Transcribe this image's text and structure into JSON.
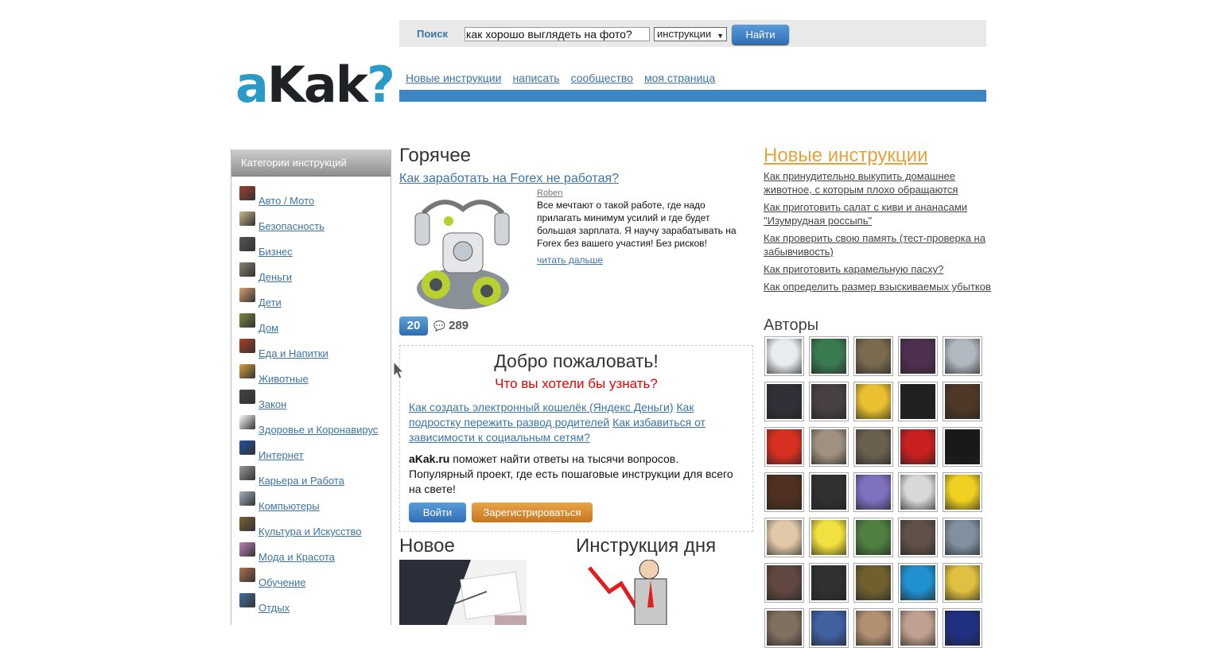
{
  "search": {
    "label": "Поиск",
    "value": "как хорошо выглядеть на фото?",
    "select_value": "инструкции",
    "button": "Найти"
  },
  "logo": {
    "part1": "a",
    "part2": "Kak",
    "part3": "?"
  },
  "nav": [
    "Новые инструкции",
    "написать",
    "сообщество",
    "моя страница"
  ],
  "sidebar": {
    "title": "Категории инструкций",
    "items": [
      {
        "label": "Авто / Мото",
        "color": "#a04030"
      },
      {
        "label": "Безопасность",
        "color": "#c9b58a"
      },
      {
        "label": "Бизнес",
        "color": "#555555"
      },
      {
        "label": "Деньги",
        "color": "#8a8070"
      },
      {
        "label": "Дети",
        "color": "#d9a070"
      },
      {
        "label": "Дом",
        "color": "#7a8a40"
      },
      {
        "label": "Еда и Напитки",
        "color": "#b04020"
      },
      {
        "label": "Животные",
        "color": "#d9a040"
      },
      {
        "label": "Закон",
        "color": "#444444"
      },
      {
        "label": "Здоровье и Коронавирус",
        "color": "#ffffff"
      },
      {
        "label": "Интернет",
        "color": "#2050a0"
      },
      {
        "label": "Карьера и Работа",
        "color": "#999999"
      },
      {
        "label": "Компьютеры",
        "color": "#a0b0c0"
      },
      {
        "label": "Культура и Искусство",
        "color": "#806030"
      },
      {
        "label": "Мода и Красота",
        "color": "#c080c0"
      },
      {
        "label": "Обучение",
        "color": "#b07050"
      },
      {
        "label": "Отдых",
        "color": "#4070a0"
      }
    ]
  },
  "hot": {
    "title": "Горячее",
    "link": "Как заработать на Forex не работая?",
    "author": "Roben",
    "text": "Все мечтают о такой работе, где надо прилагать минимум усилий и где будет большая зарплата. Я научу зарабатывать на Forex без вашего участия! Без рисков!",
    "read_more": "читать дальше",
    "rating": "20",
    "comments": "289"
  },
  "welcome": {
    "title": "Добро пожаловать!",
    "subtitle": "Что вы хотели бы узнать?",
    "links": [
      "Как создать электронный кошелёк (Яндекс Деньги)",
      "Как подростку пережить развод родителей",
      "Как избавиться от зависимости к социальным сетям?"
    ],
    "brand": "aKak.ru",
    "text": " поможет найти ответы на тысячи вопросов. Популярный проект, где есть пошаговые инструкции для всего на свете!",
    "login": "Войти",
    "register": "Зарегистрироваться"
  },
  "sections": {
    "new": "Новое",
    "day": "Инструкция дня"
  },
  "new_instructions": {
    "title": "Новые инструкции",
    "items": [
      "Как принудительно выкупить домашнее животное, с которым плохо обращаются",
      "Как приготовить салат с киви и ананасами \"Изумрудная россыпь\"",
      "Как проверить свою память (тест-проверка на забывчивость)",
      "Как приготовить карамельную пасху?",
      "Как определить размер взыскиваемых убытков"
    ]
  },
  "authors": {
    "title": "Авторы",
    "avatars": [
      "#e8ecef",
      "#3a7a50",
      "#7a6a50",
      "#503050",
      "#b0b8c0",
      "#303038",
      "#484040",
      "#e8c030",
      "#202020",
      "#503828",
      "#d83020",
      "#a09080",
      "#6a6050",
      "#c82020",
      "#181818",
      "#503020",
      "#303030",
      "#8070c0",
      "#d8d8d8",
      "#f0d020",
      "#e0c8a8",
      "#f0e040",
      "#508040",
      "#605048",
      "#8090a0",
      "#604840",
      "#303030",
      "#706030",
      "#2090d0",
      "#e0c040",
      "#807060",
      "#4060a0",
      "#b09070",
      "#c0a090",
      "#203080"
    ]
  }
}
